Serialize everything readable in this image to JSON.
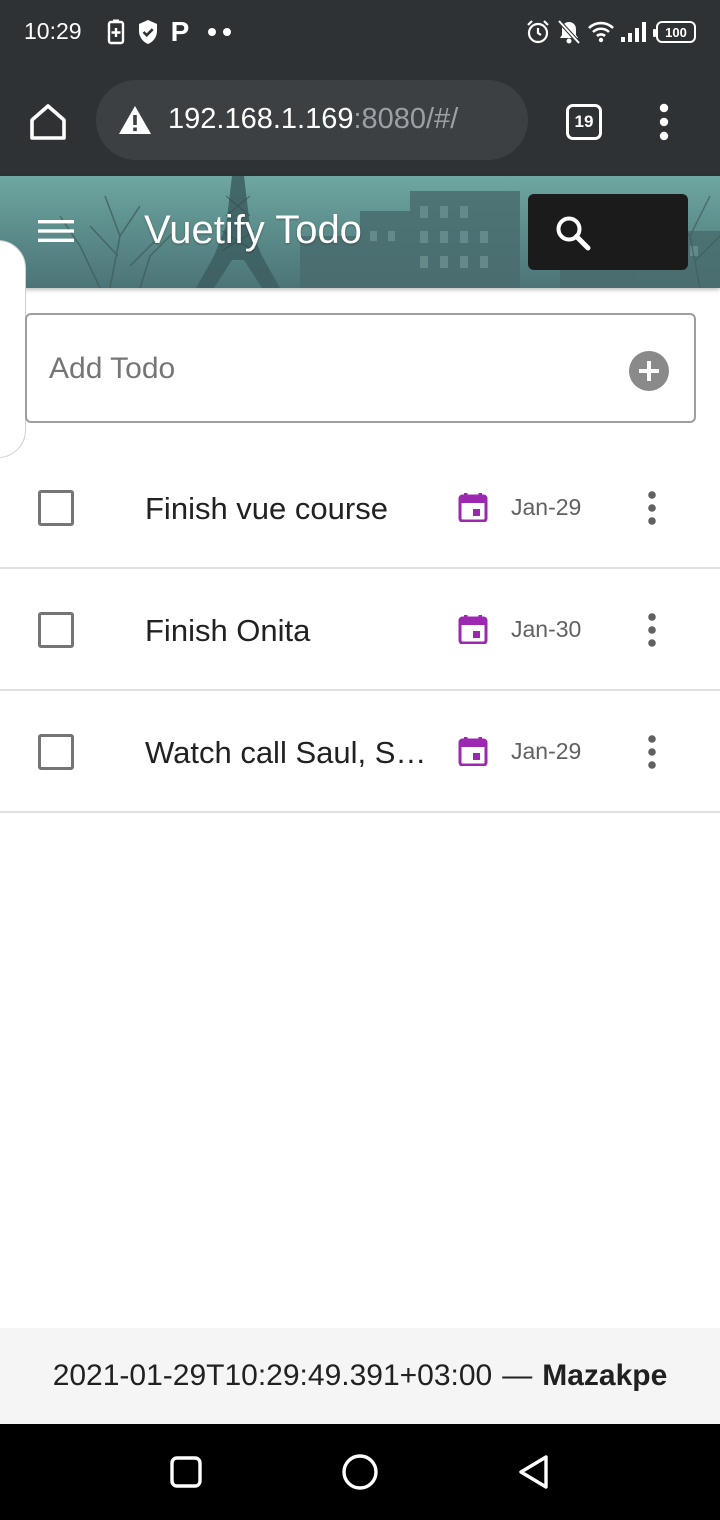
{
  "status_bar": {
    "time": "10:29",
    "left_icons": [
      "battery-saver-icon",
      "shield-icon",
      "p-icon",
      "more-dots-icon"
    ],
    "p_glyph": "P",
    "right_icons": [
      "alarm-icon",
      "bell-off-icon",
      "wifi-icon",
      "signal-icon",
      "battery-icon"
    ],
    "battery_level": "100"
  },
  "browser": {
    "url_host": "192.168.1.169",
    "url_rest": ":8080/#/",
    "tab_count": "19",
    "security_icon": "warning-icon"
  },
  "app": {
    "title": "Vuetify Todo",
    "header_bg_color": "#5d8f8d"
  },
  "add_todo": {
    "placeholder": "Add Todo",
    "value": ""
  },
  "todos": [
    {
      "title": "Finish vue course",
      "date": "Jan-29",
      "done": false
    },
    {
      "title": "Finish Onita",
      "date": "Jan-30",
      "done": false
    },
    {
      "title": "Watch call Saul, Se…",
      "date": "Jan-29",
      "done": false
    }
  ],
  "colors": {
    "calendar_accent": "#9c27b0",
    "status_bar_bg": "#2f3235",
    "footer_bg": "#f5f5f5"
  },
  "footer": {
    "timestamp": "2021-01-29T10:29:49.391+03:00",
    "separator": "—",
    "author": "Mazakpe"
  },
  "nav_bar": {
    "buttons": [
      "recents-icon",
      "home-icon",
      "back-icon"
    ]
  }
}
